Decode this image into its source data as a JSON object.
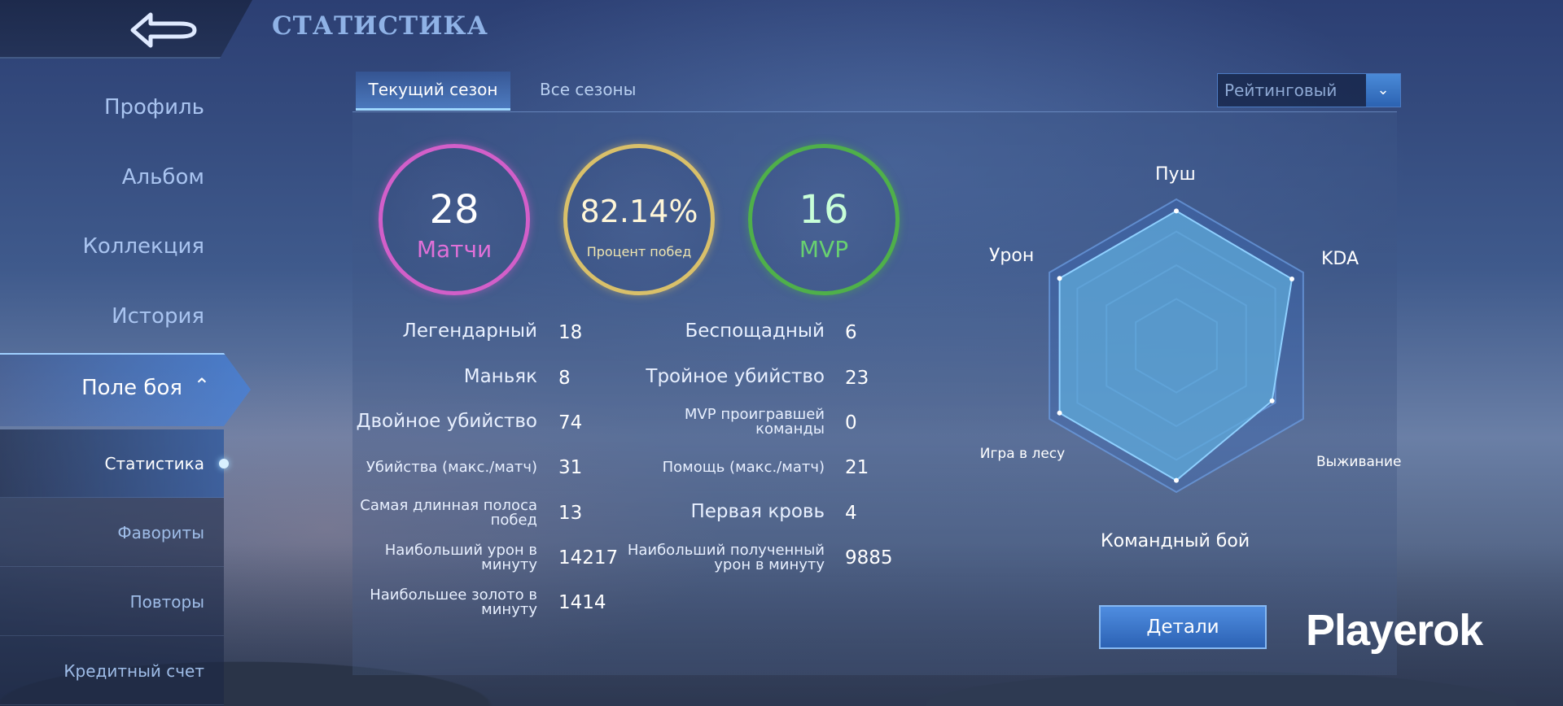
{
  "header": {
    "title": "СТАТИСТИКА",
    "back_icon": "back-arrow-icon"
  },
  "sidebar": {
    "items": [
      {
        "label": "Профиль"
      },
      {
        "label": "Альбом"
      },
      {
        "label": "Коллекция"
      },
      {
        "label": "История"
      }
    ],
    "active_label": "Поле боя",
    "sub_items": [
      {
        "label": "Статистика"
      },
      {
        "label": "Фавориты"
      },
      {
        "label": "Повторы"
      },
      {
        "label": "Кредитный счет"
      }
    ]
  },
  "tabs": {
    "current": "Текущий сезон",
    "all": "Все сезоны"
  },
  "mode_select": {
    "value": "Рейтинговый"
  },
  "summary": {
    "matches": {
      "value": "28",
      "label": "Матчи",
      "color": "#d25fc9"
    },
    "winrate": {
      "value": "82.14%",
      "label": "Процент побед",
      "color": "#d9c06a"
    },
    "mvp": {
      "value": "16",
      "label": "MVP",
      "color": "#4fb04a"
    }
  },
  "stats_left": [
    {
      "label": "Легендарный",
      "value": "18"
    },
    {
      "label": "Маньяк",
      "value": "8"
    },
    {
      "label": "Двойное убийство",
      "value": "74"
    },
    {
      "label": "Убийства (макс./матч)",
      "value": "31"
    },
    {
      "label": "Самая длинная полоса побед",
      "value": "13"
    },
    {
      "label": "Наибольший урон в минуту",
      "value": "14217"
    },
    {
      "label": "Наибольшее золото в минуту",
      "value": "1414"
    }
  ],
  "stats_right": [
    {
      "label": "Беспощадный",
      "value": "6"
    },
    {
      "label": "Тройное убийство",
      "value": "23"
    },
    {
      "label": "MVP проигравшей команды",
      "value": "0"
    },
    {
      "label": "Помощь (макс./матч)",
      "value": "21"
    },
    {
      "label": "Первая кровь",
      "value": "4"
    },
    {
      "label": "Наибольший полученный урон в минуту",
      "value": "9885"
    }
  ],
  "radar": {
    "axes": [
      "Пуш",
      "KDA",
      "Выживание",
      "Командный бой",
      "Игра в лесу",
      "Урон"
    ],
    "values": [
      1.0,
      0.99,
      0.82,
      1.0,
      1.0,
      1.0
    ],
    "fill_color": "#5fa9d9"
  },
  "details_button": {
    "label": "Детали"
  },
  "watermark": {
    "text": "Playerok"
  }
}
